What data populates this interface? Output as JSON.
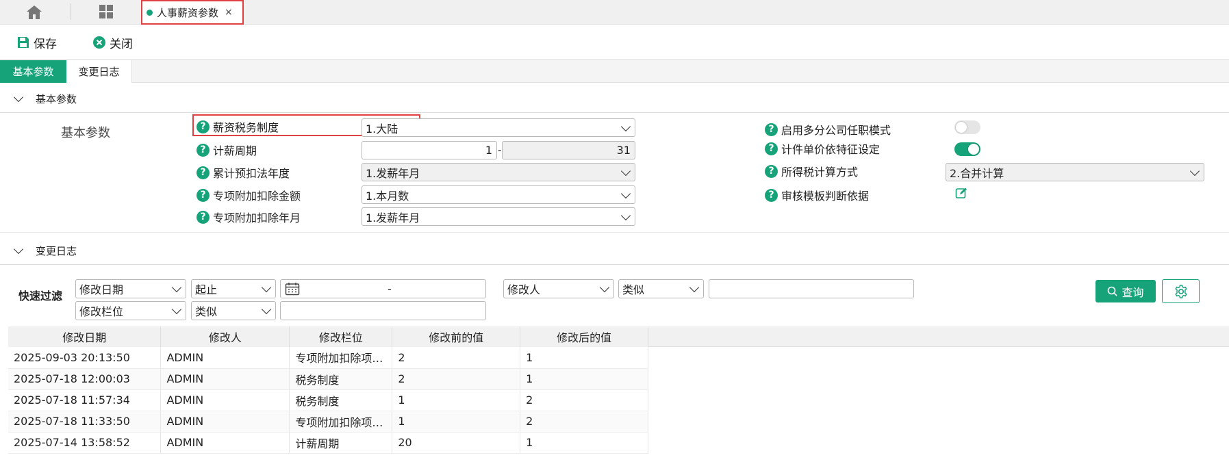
{
  "tabs": {
    "active_label": "人事薪资参数",
    "close_glyph": "×"
  },
  "toolbar": {
    "save_label": "保存",
    "close_label": "关闭"
  },
  "subtabs": {
    "basic": "基本参数",
    "log": "变更日志"
  },
  "basic_section": {
    "title": "基本参数",
    "group_label": "基本参数",
    "left_fields": [
      {
        "label": "薪资税务制度",
        "value": "1.大陆"
      },
      {
        "label": "计薪周期",
        "from": "1",
        "separator": "-",
        "to": "31"
      },
      {
        "label": "累计预扣法年度",
        "value": "1.发薪年月"
      },
      {
        "label": "专项附加扣除金额",
        "value": "1.本月数"
      },
      {
        "label": "专项附加扣除年月",
        "value": "1.发薪年月"
      }
    ],
    "right_fields": [
      {
        "label": "启用多分公司任职模式",
        "toggle": false
      },
      {
        "label": "计件单价依特征设定",
        "toggle": true
      },
      {
        "label": "所得税计算方式",
        "value": "2.合并计算"
      },
      {
        "label": "审核模板判断依据",
        "icon": "edit-icon"
      }
    ]
  },
  "log_section": {
    "title": "变更日志",
    "filter_title": "快速过滤",
    "filters": {
      "row1": {
        "field": "修改日期",
        "op": "起止",
        "range_sep": "-",
        "field2": "修改人",
        "op2": "类似",
        "value2": ""
      },
      "row2": {
        "field": "修改栏位",
        "op": "类似",
        "value": ""
      }
    },
    "query_label": "查询",
    "columns": [
      "修改日期",
      "修改人",
      "修改栏位",
      "修改前的值",
      "修改后的值"
    ],
    "rows": [
      [
        "2025-09-03 20:13:50",
        "ADMIN",
        "专项附加扣除项…",
        "2",
        "1"
      ],
      [
        "2025-07-18 12:00:03",
        "ADMIN",
        "税务制度",
        "2",
        "1"
      ],
      [
        "2025-07-18 11:57:34",
        "ADMIN",
        "税务制度",
        "1",
        "2"
      ],
      [
        "2025-07-18 11:33:50",
        "ADMIN",
        "专项附加扣除项…",
        "1",
        "2"
      ],
      [
        "2025-07-14 13:58:52",
        "ADMIN",
        "计薪周期",
        "20",
        "1"
      ]
    ]
  },
  "colors": {
    "accent": "#16a37a",
    "highlight": "#e04040"
  }
}
